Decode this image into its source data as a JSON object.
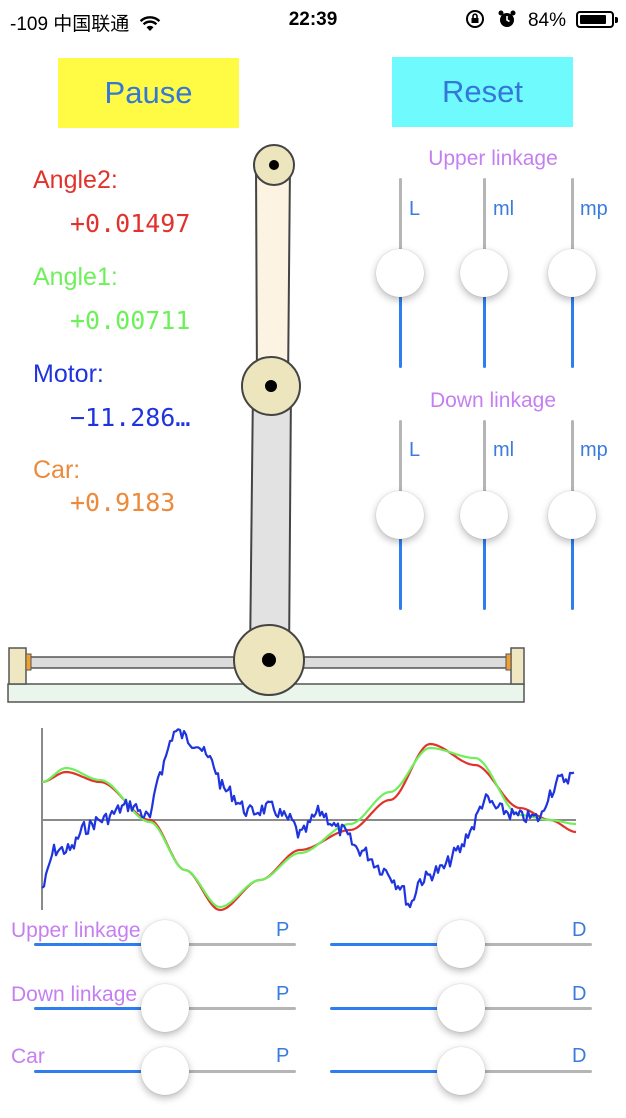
{
  "status_bar": {
    "signal_text": "-109 中国联通",
    "wifi_icon": "wifi-icon",
    "time": "22:39",
    "lock_icon": "rotation-lock-icon",
    "alarm_icon": "alarm-icon",
    "battery_percent": "84%",
    "battery_level": 0.84
  },
  "buttons": {
    "pause_label": "Pause",
    "pause_color": "#fffb44",
    "reset_label": "Reset",
    "reset_color": "#6ffbfd"
  },
  "readouts": {
    "angle2_label": "Angle2:",
    "angle2_value": "+0.01497",
    "angle2_color": "#e1322c",
    "angle1_label": "Angle1:",
    "angle1_value": "+0.00711",
    "angle1_color": "#6ef05b",
    "motor_label": "Motor:",
    "motor_value": "−11.286…",
    "motor_color": "#1f34de",
    "car_label": "Car:",
    "car_value": "+0.9183",
    "car_color": "#ec8a3b"
  },
  "upper_linkage": {
    "title": "Upper linkage",
    "sliders": [
      {
        "label": "L",
        "value": 0.5
      },
      {
        "label": "ml",
        "value": 0.5
      },
      {
        "label": "mp",
        "value": 0.5
      }
    ]
  },
  "down_linkage": {
    "title": "Down linkage",
    "sliders": [
      {
        "label": "L",
        "value": 0.5
      },
      {
        "label": "ml",
        "value": 0.5
      },
      {
        "label": "mp",
        "value": 0.5
      }
    ]
  },
  "pid": {
    "rows": [
      {
        "title": "Upper linkage",
        "p_label": "P",
        "d_label": "D",
        "p_value": 0.5,
        "d_value": 0.5
      },
      {
        "title": "Down linkage",
        "p_label": "P",
        "d_label": "D",
        "p_value": 0.5,
        "d_value": 0.5
      },
      {
        "title": "Car",
        "p_label": "P",
        "d_label": "D",
        "p_value": 0.5,
        "d_value": 0.5
      }
    ]
  },
  "graph": {
    "series_colors": {
      "angle2": "#e1322c",
      "angle1": "#6ef05b",
      "motor": "#1f34de"
    }
  }
}
